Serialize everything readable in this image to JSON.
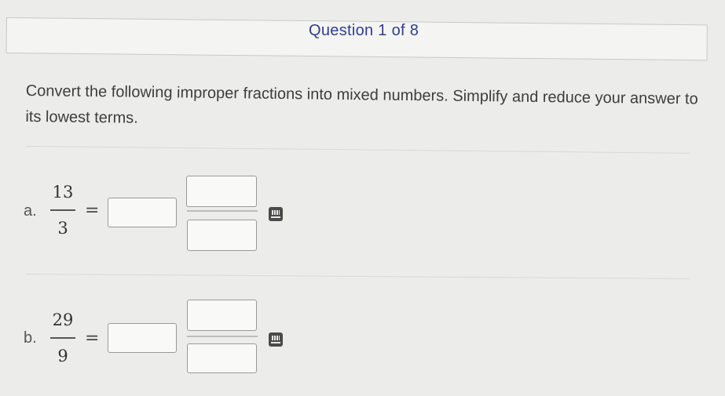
{
  "header": {
    "title": "Question 1 of 8"
  },
  "instructions": "Convert the following improper fractions into mixed numbers. Simplify and reduce your answer to its lowest terms.",
  "problems": [
    {
      "label": "a.",
      "numerator": "13",
      "denominator": "3",
      "equals": "="
    },
    {
      "label": "b.",
      "numerator": "29",
      "denominator": "9",
      "equals": "="
    }
  ],
  "icons": {
    "answer_tool": "keypad-icon"
  }
}
